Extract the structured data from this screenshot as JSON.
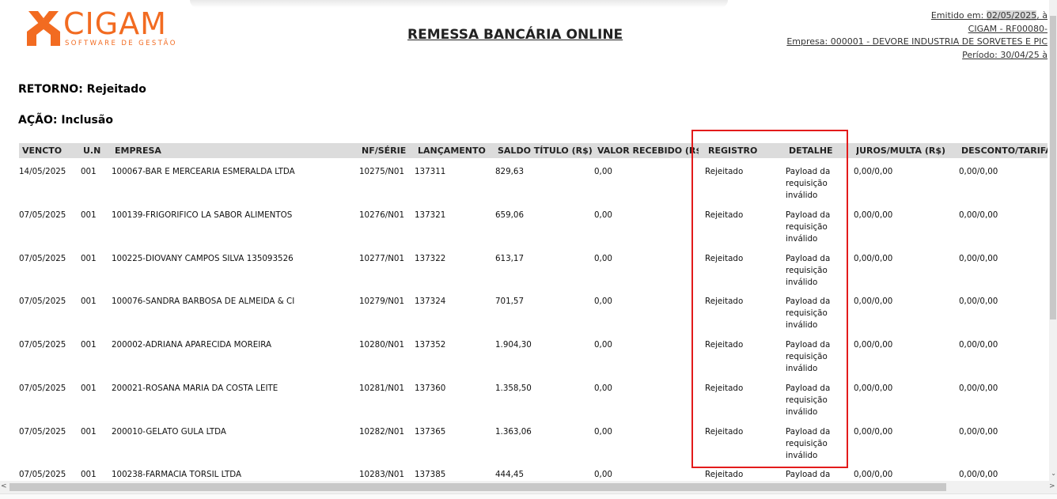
{
  "logo": {
    "name": "CIGAM",
    "tagline": "SOFTWARE DE GESTÃO"
  },
  "report_title": "REMESSA BANCÁRIA ONLINE",
  "header_right": {
    "emitido_label": "Emitido em: ",
    "emitido_date": "02/05/2025",
    "emitido_suffix": ", à",
    "code": "CIGAM - RF00080-",
    "empresa": "Empresa: 000001 - DEVORE INDUSTRIA DE SORVETES E PIC",
    "periodo": "Período: 30/04/25 à"
  },
  "retorno": "RETORNO: Rejeitado",
  "acao": "AÇÃO: Inclusão",
  "columns": [
    "VENCTO",
    "U.N",
    "EMPRESA",
    "NF/SÉRIE",
    "LANÇAMENTO",
    "SALDO TÍTULO (R$)",
    "VALOR RECEBIDO (R$)",
    "REGISTRO",
    "DETALHE",
    "JUROS/MULTA (R$)",
    "DESCONTO/TARIFA"
  ],
  "rows": [
    {
      "vencto": "14/05/2025",
      "un": "001",
      "empresa": "100067-BAR E MERCEARIA ESMERALDA LTDA",
      "nf": "10275/N01",
      "lanc": "137311",
      "saldo": "829,63",
      "valor": "0,00",
      "registro": "Rejeitado",
      "detalhe": "Payload da requisição inválido",
      "juros": "0,00/0,00",
      "desconto": "0,00/0,00"
    },
    {
      "vencto": "07/05/2025",
      "un": "001",
      "empresa": "100139-FRIGORIFICO LA SABOR ALIMENTOS",
      "nf": "10276/N01",
      "lanc": "137321",
      "saldo": "659,06",
      "valor": "0,00",
      "registro": "Rejeitado",
      "detalhe": "Payload da requisição inválido",
      "juros": "0,00/0,00",
      "desconto": "0,00/0,00"
    },
    {
      "vencto": "07/05/2025",
      "un": "001",
      "empresa": "100225-DIOVANY CAMPOS SILVA 135093526",
      "nf": "10277/N01",
      "lanc": "137322",
      "saldo": "613,17",
      "valor": "0,00",
      "registro": "Rejeitado",
      "detalhe": "Payload da requisição inválido",
      "juros": "0,00/0,00",
      "desconto": "0,00/0,00"
    },
    {
      "vencto": "07/05/2025",
      "un": "001",
      "empresa": "100076-SANDRA BARBOSA DE ALMEIDA & CI",
      "nf": "10279/N01",
      "lanc": "137324",
      "saldo": "701,57",
      "valor": "0,00",
      "registro": "Rejeitado",
      "detalhe": "Payload da requisição inválido",
      "juros": "0,00/0,00",
      "desconto": "0,00/0,00"
    },
    {
      "vencto": "07/05/2025",
      "un": "001",
      "empresa": "200002-ADRIANA APARECIDA MOREIRA",
      "nf": "10280/N01",
      "lanc": "137352",
      "saldo": "1.904,30",
      "valor": "0,00",
      "registro": "Rejeitado",
      "detalhe": "Payload da requisição inválido",
      "juros": "0,00/0,00",
      "desconto": "0,00/0,00"
    },
    {
      "vencto": "07/05/2025",
      "un": "001",
      "empresa": "200021-ROSANA MARIA DA COSTA LEITE",
      "nf": "10281/N01",
      "lanc": "137360",
      "saldo": "1.358,50",
      "valor": "0,00",
      "registro": "Rejeitado",
      "detalhe": "Payload da requisição inválido",
      "juros": "0,00/0,00",
      "desconto": "0,00/0,00"
    },
    {
      "vencto": "07/05/2025",
      "un": "001",
      "empresa": "200010-GELATO GULA LTDA",
      "nf": "10282/N01",
      "lanc": "137365",
      "saldo": "1.363,06",
      "valor": "0,00",
      "registro": "Rejeitado",
      "detalhe": "Payload da requisição inválido",
      "juros": "0,00/0,00",
      "desconto": "0,00/0,00"
    },
    {
      "vencto": "07/05/2025",
      "un": "001",
      "empresa": "100238-FARMACIA TORSIL LTDA",
      "nf": "10283/N01",
      "lanc": "137385",
      "saldo": "444,45",
      "valor": "0,00",
      "registro": "Rejeitado",
      "detalhe": "Payload da",
      "juros": "0,00/0,00",
      "desconto": "0,00/0,00"
    }
  ],
  "colors": {
    "brand": "#f26b21",
    "highlight_box": "#e31b1b",
    "header_bg": "#dcdcdc"
  }
}
